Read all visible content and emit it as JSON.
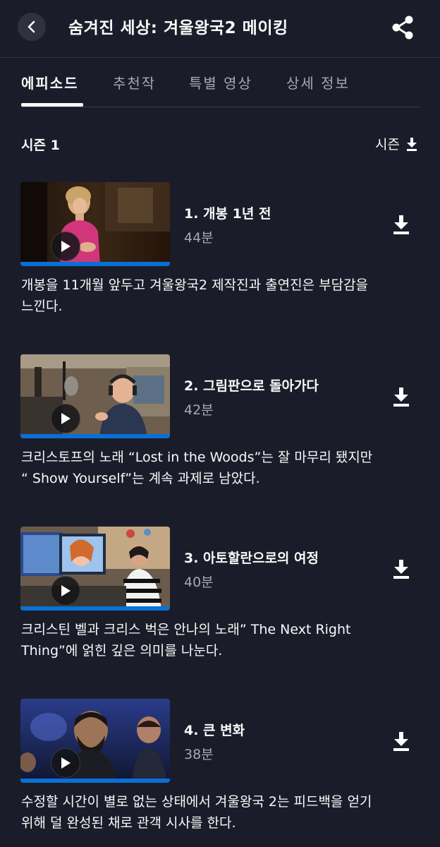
{
  "header": {
    "title": "숨겨진 세상: 겨울왕국2 메이킹",
    "back_icon": "chevron-left-icon",
    "share_icon": "share-icon"
  },
  "tabs": [
    {
      "label": "에피소드",
      "active": true
    },
    {
      "label": "추천작",
      "active": false
    },
    {
      "label": "특별 영상",
      "active": false
    },
    {
      "label": "상세 정보",
      "active": false
    }
  ],
  "season": {
    "label": "시즌 1",
    "download_label": "시즌",
    "download_icon": "download-icon"
  },
  "episodes": [
    {
      "title": "1. 개봉 1년 전",
      "duration": "44분",
      "description_lines": [
        "개봉을 11개월 앞두고 겨울왕국2 제작진과 출연진은 부담감을",
        "느낀다."
      ]
    },
    {
      "title": "2. 그림판으로 돌아가다",
      "duration": "42분",
      "description_lines": [
        "크리스토프의 노래 “Lost in the Woods”는 잘 마무리 됐지만",
        "“ Show Yourself”는 계속 과제로 남았다."
      ]
    },
    {
      "title": "3. 아토할란으로의 여정",
      "duration": "40분",
      "description_lines": [
        "크리스틴 벨과 크리스 벅은 안나의 노래” The Next Right",
        "Thing”에 얽힌 깊은 의미를 나눈다."
      ]
    },
    {
      "title": "4. 큰 변화",
      "duration": "38분",
      "description_lines": [
        "수정할 시간이 별로 없는 상태에서 겨울왕국 2는 피드백을 얻기",
        "위해 덜 완성된 채로 관객 시사를 한다."
      ]
    }
  ],
  "colors": {
    "background": "#1a1d29",
    "accent_progress": "#0a6fd6",
    "text_primary": "#f9f9f9",
    "text_secondary": "#a8a9ad"
  }
}
